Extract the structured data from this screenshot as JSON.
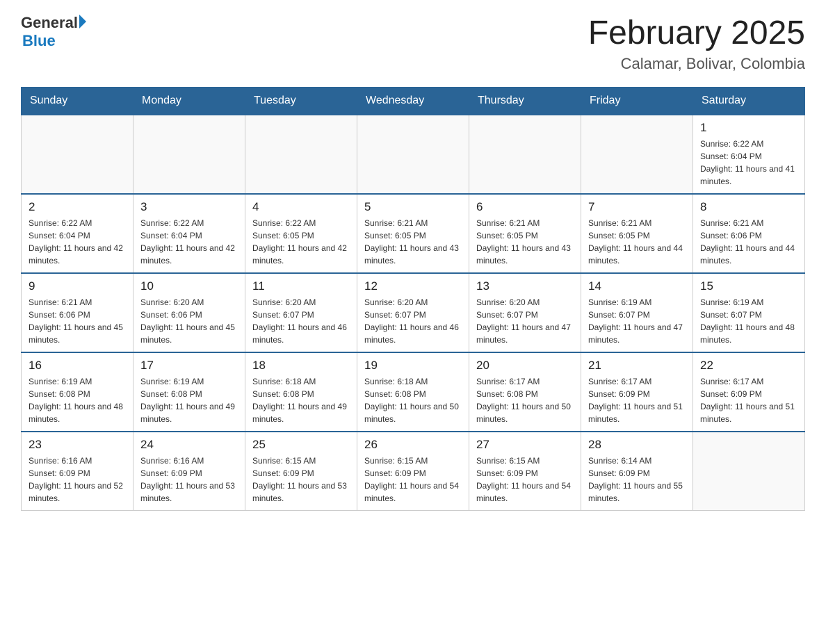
{
  "header": {
    "logo_general": "General",
    "logo_blue": "Blue",
    "month_title": "February 2025",
    "location": "Calamar, Bolivar, Colombia"
  },
  "weekdays": [
    "Sunday",
    "Monday",
    "Tuesday",
    "Wednesday",
    "Thursday",
    "Friday",
    "Saturday"
  ],
  "weeks": [
    [
      {
        "day": "",
        "info": ""
      },
      {
        "day": "",
        "info": ""
      },
      {
        "day": "",
        "info": ""
      },
      {
        "day": "",
        "info": ""
      },
      {
        "day": "",
        "info": ""
      },
      {
        "day": "",
        "info": ""
      },
      {
        "day": "1",
        "info": "Sunrise: 6:22 AM\nSunset: 6:04 PM\nDaylight: 11 hours and 41 minutes."
      }
    ],
    [
      {
        "day": "2",
        "info": "Sunrise: 6:22 AM\nSunset: 6:04 PM\nDaylight: 11 hours and 42 minutes."
      },
      {
        "day": "3",
        "info": "Sunrise: 6:22 AM\nSunset: 6:04 PM\nDaylight: 11 hours and 42 minutes."
      },
      {
        "day": "4",
        "info": "Sunrise: 6:22 AM\nSunset: 6:05 PM\nDaylight: 11 hours and 42 minutes."
      },
      {
        "day": "5",
        "info": "Sunrise: 6:21 AM\nSunset: 6:05 PM\nDaylight: 11 hours and 43 minutes."
      },
      {
        "day": "6",
        "info": "Sunrise: 6:21 AM\nSunset: 6:05 PM\nDaylight: 11 hours and 43 minutes."
      },
      {
        "day": "7",
        "info": "Sunrise: 6:21 AM\nSunset: 6:05 PM\nDaylight: 11 hours and 44 minutes."
      },
      {
        "day": "8",
        "info": "Sunrise: 6:21 AM\nSunset: 6:06 PM\nDaylight: 11 hours and 44 minutes."
      }
    ],
    [
      {
        "day": "9",
        "info": "Sunrise: 6:21 AM\nSunset: 6:06 PM\nDaylight: 11 hours and 45 minutes."
      },
      {
        "day": "10",
        "info": "Sunrise: 6:20 AM\nSunset: 6:06 PM\nDaylight: 11 hours and 45 minutes."
      },
      {
        "day": "11",
        "info": "Sunrise: 6:20 AM\nSunset: 6:07 PM\nDaylight: 11 hours and 46 minutes."
      },
      {
        "day": "12",
        "info": "Sunrise: 6:20 AM\nSunset: 6:07 PM\nDaylight: 11 hours and 46 minutes."
      },
      {
        "day": "13",
        "info": "Sunrise: 6:20 AM\nSunset: 6:07 PM\nDaylight: 11 hours and 47 minutes."
      },
      {
        "day": "14",
        "info": "Sunrise: 6:19 AM\nSunset: 6:07 PM\nDaylight: 11 hours and 47 minutes."
      },
      {
        "day": "15",
        "info": "Sunrise: 6:19 AM\nSunset: 6:07 PM\nDaylight: 11 hours and 48 minutes."
      }
    ],
    [
      {
        "day": "16",
        "info": "Sunrise: 6:19 AM\nSunset: 6:08 PM\nDaylight: 11 hours and 48 minutes."
      },
      {
        "day": "17",
        "info": "Sunrise: 6:19 AM\nSunset: 6:08 PM\nDaylight: 11 hours and 49 minutes."
      },
      {
        "day": "18",
        "info": "Sunrise: 6:18 AM\nSunset: 6:08 PM\nDaylight: 11 hours and 49 minutes."
      },
      {
        "day": "19",
        "info": "Sunrise: 6:18 AM\nSunset: 6:08 PM\nDaylight: 11 hours and 50 minutes."
      },
      {
        "day": "20",
        "info": "Sunrise: 6:17 AM\nSunset: 6:08 PM\nDaylight: 11 hours and 50 minutes."
      },
      {
        "day": "21",
        "info": "Sunrise: 6:17 AM\nSunset: 6:09 PM\nDaylight: 11 hours and 51 minutes."
      },
      {
        "day": "22",
        "info": "Sunrise: 6:17 AM\nSunset: 6:09 PM\nDaylight: 11 hours and 51 minutes."
      }
    ],
    [
      {
        "day": "23",
        "info": "Sunrise: 6:16 AM\nSunset: 6:09 PM\nDaylight: 11 hours and 52 minutes."
      },
      {
        "day": "24",
        "info": "Sunrise: 6:16 AM\nSunset: 6:09 PM\nDaylight: 11 hours and 53 minutes."
      },
      {
        "day": "25",
        "info": "Sunrise: 6:15 AM\nSunset: 6:09 PM\nDaylight: 11 hours and 53 minutes."
      },
      {
        "day": "26",
        "info": "Sunrise: 6:15 AM\nSunset: 6:09 PM\nDaylight: 11 hours and 54 minutes."
      },
      {
        "day": "27",
        "info": "Sunrise: 6:15 AM\nSunset: 6:09 PM\nDaylight: 11 hours and 54 minutes."
      },
      {
        "day": "28",
        "info": "Sunrise: 6:14 AM\nSunset: 6:09 PM\nDaylight: 11 hours and 55 minutes."
      },
      {
        "day": "",
        "info": ""
      }
    ]
  ]
}
